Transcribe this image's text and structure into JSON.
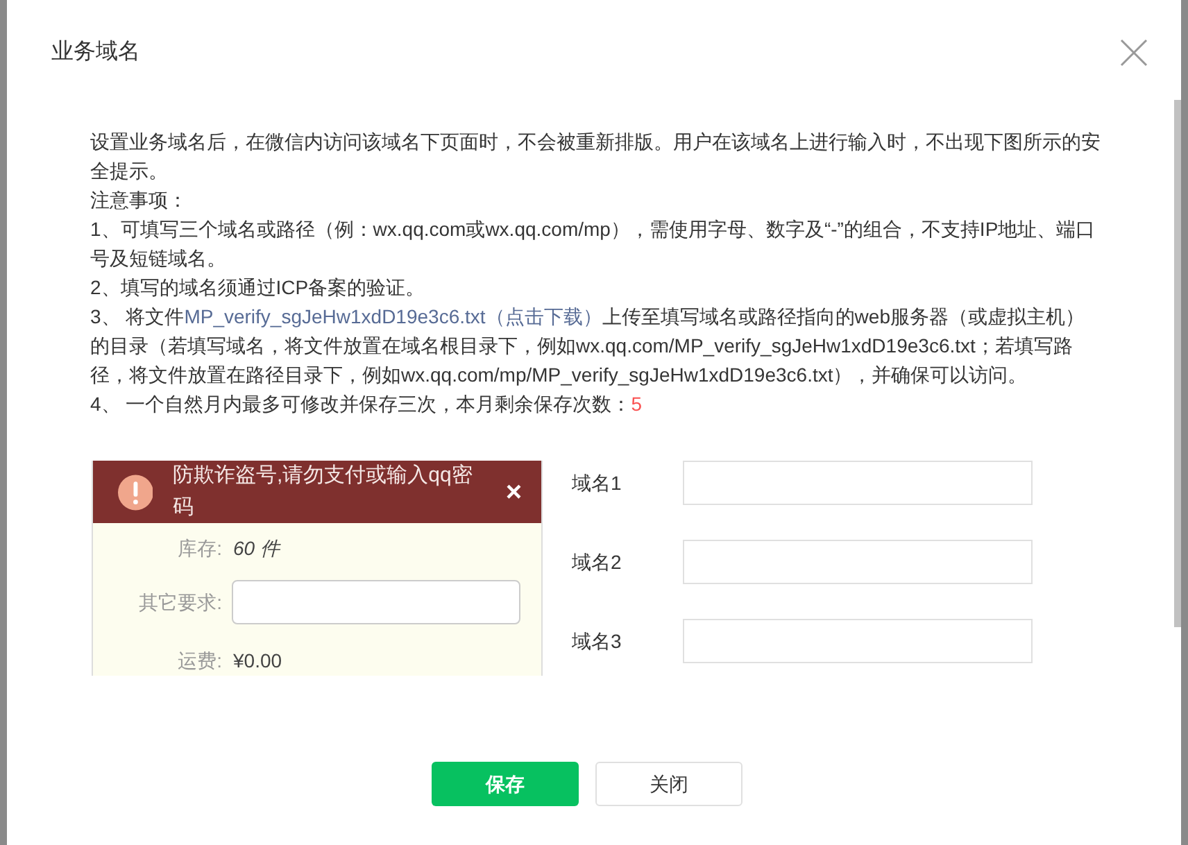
{
  "dialog": {
    "title": "业务域名"
  },
  "intro": "设置业务域名后，在微信内访问该域名下页面时，不会被重新排版。用户在该域名上进行输入时，不出现下图所示的安全提示。",
  "notes_title": "注意事项：",
  "notes": [
    {
      "kind": "plain",
      "text": "1、可填写三个域名或路径（例：wx.qq.com或wx.qq.com/mp），需使用字母、数字及“-”的组合，不支持IP地址、端口号及短链域名。"
    },
    {
      "kind": "plain",
      "text": "2、填写的域名须通过ICP备案的验证。"
    },
    {
      "kind": "link",
      "before": "3、 将文件",
      "link": "MP_verify_sgJeHw1xdD19e3c6.txt（点击下载）",
      "after": "上传至填写域名或路径指向的web服务器（或虚拟主机）的目录（若填写域名，将文件放置在域名根目录下，例如wx.qq.com/MP_verify_sgJeHw1xdD19e3c6.txt；若填写路径，将文件放置在路径目录下，例如wx.qq.com/mp/MP_verify_sgJeHw1xdD19e3c6.txt），并确保可以访问。"
    },
    {
      "kind": "count",
      "text": "4、 一个自然月内最多可修改并保存三次，本月剩余保存次数：",
      "count": "5"
    }
  ],
  "example": {
    "warning": "防欺诈盗号,请勿支付或输入qq密码",
    "close": "×",
    "stock_label": "库存:",
    "stock_value": "60 件",
    "other_label": "其它要求:",
    "fee_label": "运费:",
    "fee_value": "¥0.00"
  },
  "domains": [
    {
      "label": "域名1"
    },
    {
      "label": "域名2"
    },
    {
      "label": "域名3"
    }
  ],
  "buttons": {
    "save": "保存",
    "close": "关闭"
  }
}
